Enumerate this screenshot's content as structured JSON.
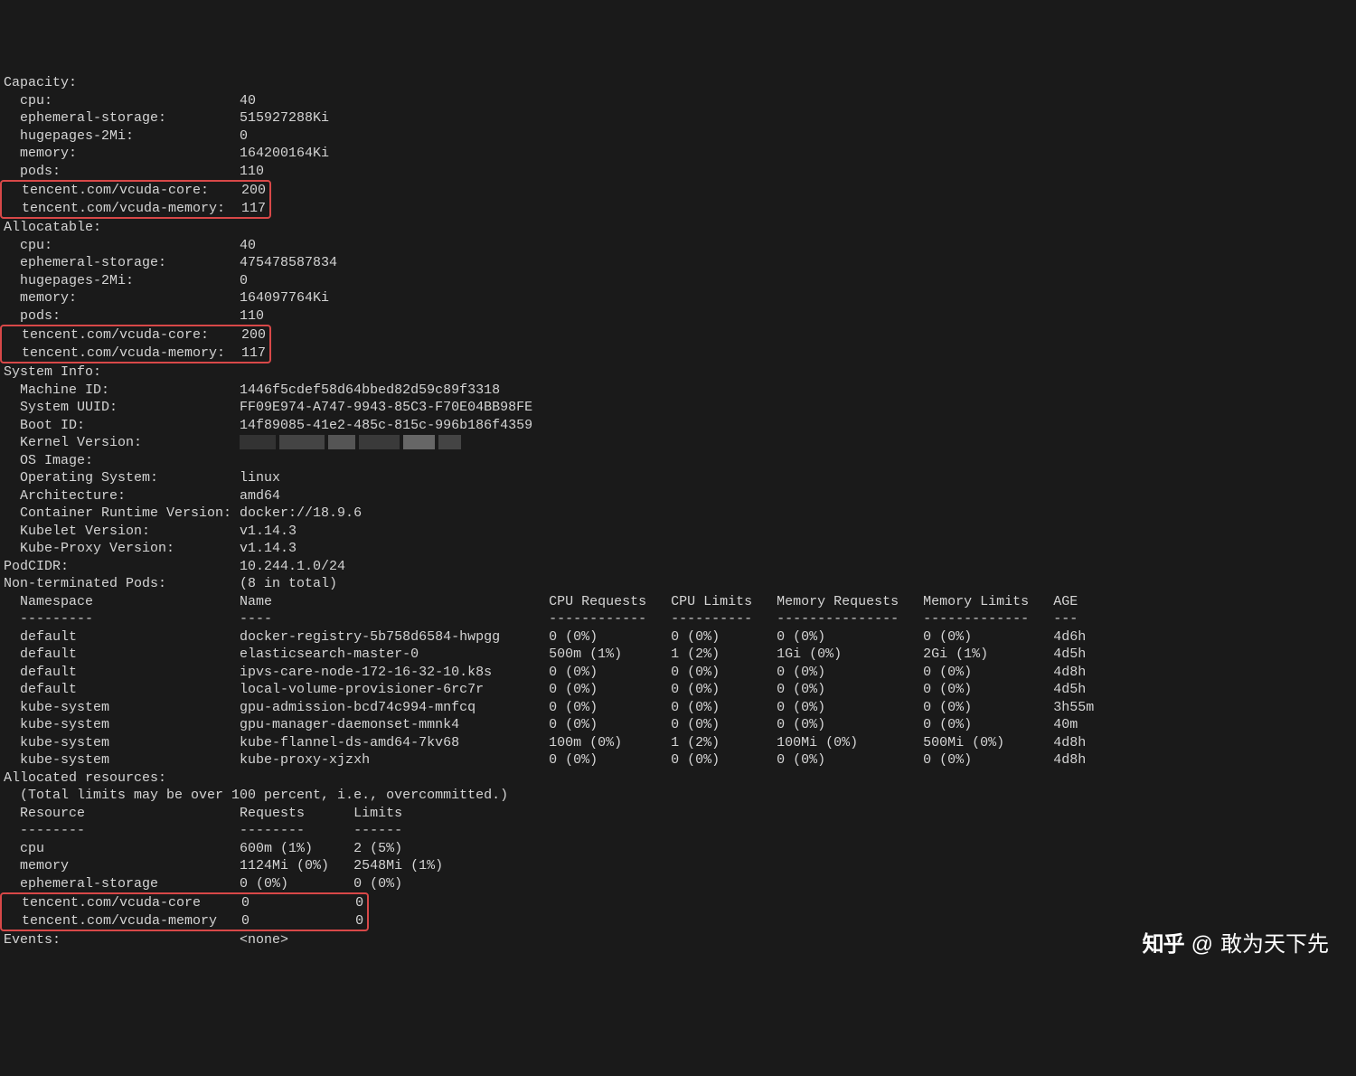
{
  "capacity": {
    "header": "Capacity:",
    "cpu_label": "  cpu:",
    "cpu_val": "40",
    "eph_label": "  ephemeral-storage:",
    "eph_val": "515927288Ki",
    "huge_label": "  hugepages-2Mi:",
    "huge_val": "0",
    "mem_label": "  memory:",
    "mem_val": "164200164Ki",
    "pods_label": "  pods:",
    "pods_val": "110",
    "vcore_label": "  tencent.com/vcuda-core:",
    "vcore_val": "200",
    "vmem_label": "  tencent.com/vcuda-memory:",
    "vmem_val": "117"
  },
  "allocatable": {
    "header": "Allocatable:",
    "cpu_label": "  cpu:",
    "cpu_val": "40",
    "eph_label": "  ephemeral-storage:",
    "eph_val": "475478587834",
    "huge_label": "  hugepages-2Mi:",
    "huge_val": "0",
    "mem_label": "  memory:",
    "mem_val": "164097764Ki",
    "pods_label": "  pods:",
    "pods_val": "110",
    "vcore_label": "  tencent.com/vcuda-core:",
    "vcore_val": "200",
    "vmem_label": "  tencent.com/vcuda-memory:",
    "vmem_val": "117"
  },
  "sysinfo": {
    "header": "System Info:",
    "machine_id_label": "  Machine ID:",
    "machine_id_val": "1446f5cdef58d64bbed82d59c89f3318",
    "uuid_label": "  System UUID:",
    "uuid_val": "FF09E974-A747-9943-85C3-F70E04BB98FE",
    "boot_label": "  Boot ID:",
    "boot_val": "14f89085-41e2-485c-815c-996b186f4359",
    "kernel_label": "  Kernel Version:",
    "os_image_label": "  OS Image:",
    "os_label": "  Operating System:",
    "os_val": "linux",
    "arch_label": "  Architecture:",
    "arch_val": "amd64",
    "runtime_label": "  Container Runtime Version:",
    "runtime_val": "docker://18.9.6",
    "kubelet_label": "  Kubelet Version:",
    "kubelet_val": "v1.14.3",
    "kubeproxy_label": "  Kube-Proxy Version:",
    "kubeproxy_val": "v1.14.3"
  },
  "podcidr": {
    "label": "PodCIDR:",
    "val": "10.244.1.0/24"
  },
  "pods": {
    "header_label": "Non-terminated Pods:",
    "header_val": "(8 in total)",
    "col_ns": "  Namespace",
    "col_name": "Name",
    "col_cpureq": "CPU Requests",
    "col_cpulim": "CPU Limits",
    "col_memreq": "Memory Requests",
    "col_memlim": "Memory Limits",
    "col_age": "AGE",
    "dash_ns": "  ---------",
    "dash_name": "----",
    "dash_cpureq": "------------",
    "dash_cpulim": "----------",
    "dash_memreq": "---------------",
    "dash_memlim": "-------------",
    "dash_age": "---",
    "rows": [
      {
        "ns": "  default",
        "name": "docker-registry-5b758d6584-hwpgg",
        "cpureq": "0 (0%)",
        "cpulim": "0 (0%)",
        "memreq": "0 (0%)",
        "memlim": "0 (0%)",
        "age": "4d6h"
      },
      {
        "ns": "  default",
        "name": "elasticsearch-master-0",
        "cpureq": "500m (1%)",
        "cpulim": "1 (2%)",
        "memreq": "1Gi (0%)",
        "memlim": "2Gi (1%)",
        "age": "4d5h"
      },
      {
        "ns": "  default",
        "name": "ipvs-care-node-172-16-32-10.k8s",
        "cpureq": "0 (0%)",
        "cpulim": "0 (0%)",
        "memreq": "0 (0%)",
        "memlim": "0 (0%)",
        "age": "4d8h"
      },
      {
        "ns": "  default",
        "name": "local-volume-provisioner-6rc7r",
        "cpureq": "0 (0%)",
        "cpulim": "0 (0%)",
        "memreq": "0 (0%)",
        "memlim": "0 (0%)",
        "age": "4d5h"
      },
      {
        "ns": "  kube-system",
        "name": "gpu-admission-bcd74c994-mnfcq",
        "cpureq": "0 (0%)",
        "cpulim": "0 (0%)",
        "memreq": "0 (0%)",
        "memlim": "0 (0%)",
        "age": "3h55m"
      },
      {
        "ns": "  kube-system",
        "name": "gpu-manager-daemonset-mmnk4",
        "cpureq": "0 (0%)",
        "cpulim": "0 (0%)",
        "memreq": "0 (0%)",
        "memlim": "0 (0%)",
        "age": "40m"
      },
      {
        "ns": "  kube-system",
        "name": "kube-flannel-ds-amd64-7kv68",
        "cpureq": "100m (0%)",
        "cpulim": "1 (2%)",
        "memreq": "100Mi (0%)",
        "memlim": "500Mi (0%)",
        "age": "4d8h"
      },
      {
        "ns": "  kube-system",
        "name": "kube-proxy-xjzxh",
        "cpureq": "0 (0%)",
        "cpulim": "0 (0%)",
        "memreq": "0 (0%)",
        "memlim": "0 (0%)",
        "age": "4d8h"
      }
    ]
  },
  "alloc": {
    "header": "Allocated resources:",
    "note": "  (Total limits may be over 100 percent, i.e., overcommitted.)",
    "col_res": "  Resource",
    "col_req": "Requests",
    "col_lim": "Limits",
    "dash_res": "  --------",
    "dash_req": "--------",
    "dash_lim": "------",
    "cpu_label": "  cpu",
    "cpu_req": "600m (1%)",
    "cpu_lim": "2 (5%)",
    "mem_label": "  memory",
    "mem_req": "1124Mi (0%)",
    "mem_lim": "2548Mi (1%)",
    "eph_label": "  ephemeral-storage",
    "eph_req": "0 (0%)",
    "eph_lim": "0 (0%)",
    "vcore_label": "  tencent.com/vcuda-core",
    "vcore_req": "0",
    "vcore_lim": "0",
    "vmem_label": "  tencent.com/vcuda-memory",
    "vmem_req": "0",
    "vmem_lim": "0"
  },
  "events": {
    "label": "Events:",
    "val": "<none>"
  },
  "watermark": {
    "logo": "知乎",
    "sep": "@",
    "author": "敢为天下先"
  }
}
